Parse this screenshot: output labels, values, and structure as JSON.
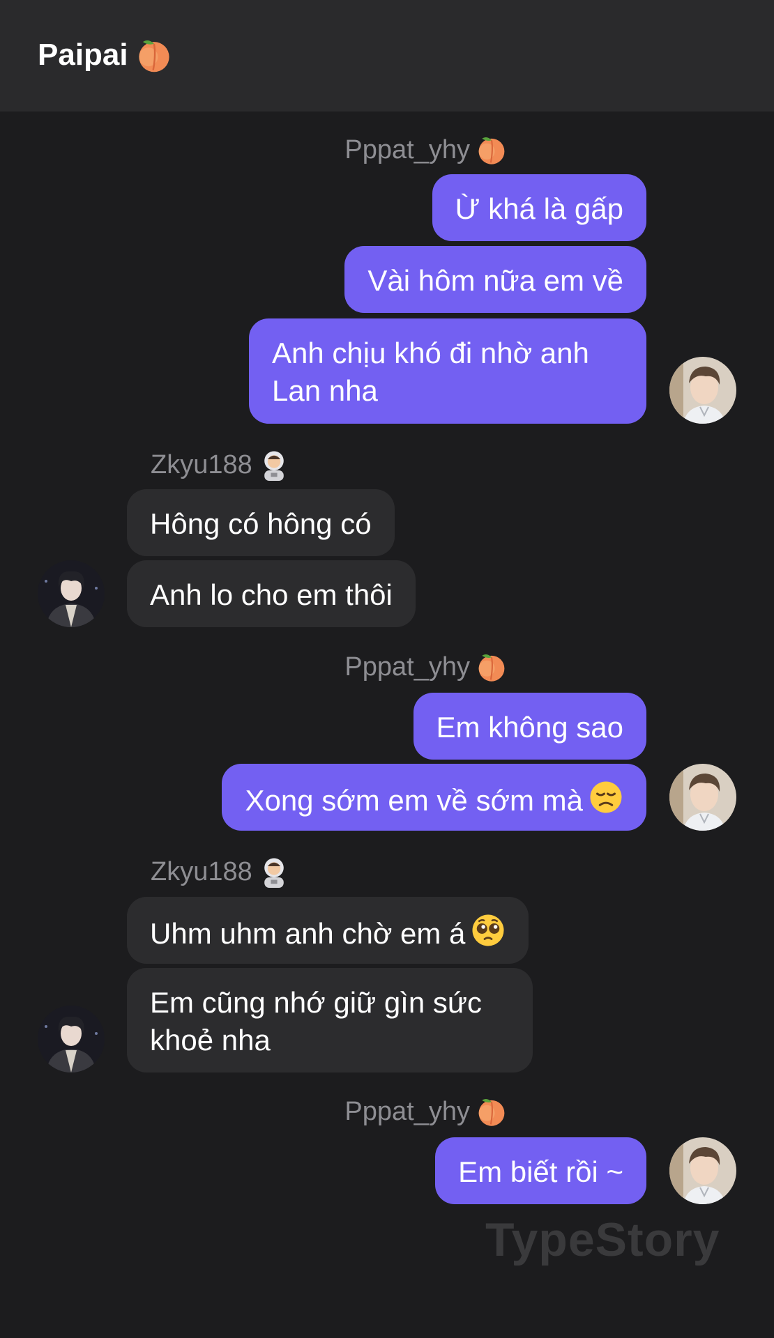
{
  "header": {
    "title": "Paipai",
    "title_emoji": "peach-emoji"
  },
  "messages": [
    {
      "sender": "Pppat_yhy",
      "sender_emoji": "peach-emoji",
      "side": "out",
      "bubbles": [
        "Ừ khá là gấp",
        "Vài hôm nữa em về",
        "Anh chịu khó đi nhờ anh Lan nha"
      ]
    },
    {
      "sender": "Zkyu188",
      "sender_emoji": "astronaut-emoji",
      "side": "in",
      "bubbles": [
        "Hông có hông có",
        "Anh lo cho em thôi"
      ]
    },
    {
      "sender": "Pppat_yhy",
      "sender_emoji": "peach-emoji",
      "side": "out",
      "bubbles": [
        "Em không sao",
        "Xong sớm em về sớm mà"
      ]
    },
    {
      "sender": "Zkyu188",
      "sender_emoji": "astronaut-emoji",
      "side": "in",
      "bubbles": [
        "Uhm uhm anh chờ em á",
        "Em cũng nhớ giữ gìn sức khoẻ nha"
      ]
    },
    {
      "sender": "Pppat_yhy",
      "sender_emoji": "peach-emoji",
      "side": "out",
      "bubbles": [
        "Em biết rồi ~"
      ]
    }
  ],
  "watermark": "TypeStory",
  "colors": {
    "background": "#1c1c1e",
    "header": "#2a2a2c",
    "outgoing_bubble": "#7360f2",
    "incoming_bubble": "#2c2c2e",
    "sender_name": "#8e8e93"
  }
}
